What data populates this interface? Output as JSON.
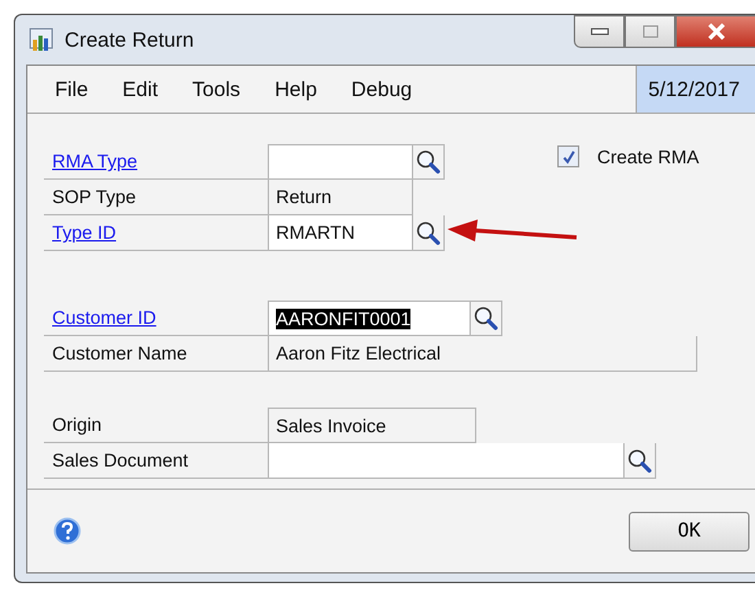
{
  "window": {
    "title": "Create Return"
  },
  "menu": [
    "File",
    "Edit",
    "Tools",
    "Help",
    "Debug"
  ],
  "date": "5/12/2017",
  "create_rma": {
    "label": "Create RMA",
    "checked": true
  },
  "groups": [
    [
      {
        "label": {
          "text": "RMA Type",
          "kind": "link"
        },
        "field": {
          "kind": "input",
          "lookup": true
        }
      },
      {
        "label": {
          "text": "SOP Type",
          "kind": "plain"
        },
        "field": {
          "kind": "readonly",
          "value": "Return",
          "lookup": false,
          "selected": false
        }
      },
      {
        "label": {
          "text": "Type ID",
          "kind": "link"
        },
        "field": {
          "kind": "input",
          "value": "RMARTN",
          "lookup": true,
          "selected": false
        }
      }
    ],
    [
      {
        "label": {
          "text": "Customer ID",
          "kind": "link"
        },
        "field": {
          "kind": "input",
          "value": "AARONFIT0001",
          "lookup": true,
          "selected": true
        }
      },
      {
        "label": {
          "text": "Customer Name",
          "kind": "plain"
        },
        "field": {
          "kind": "readonly",
          "value": "Aaron Fitz Electrical",
          "lookup": false,
          "selected": false
        }
      }
    ],
    [
      {
        "label": {
          "text": "Origin",
          "kind": "plain"
        },
        "field": {
          "kind": "readonly",
          "value": "Sales Invoice",
          "lookup": false,
          "selected": false
        }
      },
      {
        "label": {
          "text": "Sales Document",
          "kind": "plain"
        },
        "field": {
          "kind": "input",
          "lookup": true
        }
      }
    ]
  ],
  "buttons": [
    "OK"
  ]
}
